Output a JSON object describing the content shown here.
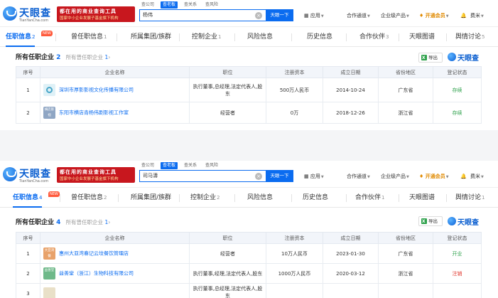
{
  "header": {
    "logo_text": "天眼查",
    "logo_sub": "TianYanCha.com",
    "banner_line1": "都在用的商业查询工具",
    "banner_line2": "国家中小企业发展子基金旗下机构",
    "search_tabs": [
      "查公司",
      "查老板",
      "查关系",
      "查风险"
    ],
    "search_btn": "天眼一下",
    "nav": [
      "应用",
      "合作通道",
      "企业级产品",
      "开通会员"
    ],
    "user": "费米"
  },
  "panels": [
    {
      "query": "杨伟",
      "tabs": [
        {
          "label": "任职信息",
          "count": "2"
        },
        {
          "label": "曾任职信息",
          "count": "1"
        },
        {
          "label": "所属集团/族群",
          "count": ""
        },
        {
          "label": "控制企业",
          "count": "1"
        },
        {
          "label": "风险信息",
          "count": ""
        },
        {
          "label": "历史信息",
          "count": ""
        },
        {
          "label": "合作伙伴",
          "count": "3"
        },
        {
          "label": "天眼图谱",
          "count": ""
        },
        {
          "label": "舆情讨论",
          "count": "5"
        }
      ],
      "section": {
        "title": "所有任职企业",
        "count": "2",
        "sub": "所有曾任职企业",
        "sub_count": "1"
      },
      "rows": [
        {
          "idx": "1",
          "logo": "",
          "logo_color": "#dff1f7",
          "company": "深圳市厚影影视文化传播有限公司",
          "position": "执行董事,总经理,法定代表人,股东",
          "capital": "500万人民币",
          "date": "2014-10-24",
          "region": "广东省",
          "status": "存续",
          "status_kind": "ok"
        },
        {
          "idx": "2",
          "logo": "横店影视",
          "logo_color": "#8fa6c4",
          "company": "东阳市横店青杨伟剧影视工作室",
          "position": "经营者",
          "capital": "0万",
          "date": "2018-12-26",
          "region": "浙江省",
          "status": "存续",
          "status_kind": "ok"
        }
      ]
    },
    {
      "query": "司马濤",
      "tabs": [
        {
          "label": "任职信息",
          "count": "4"
        },
        {
          "label": "曾任职信息",
          "count": "2"
        },
        {
          "label": "所属集团/族群",
          "count": ""
        },
        {
          "label": "控制企业",
          "count": "2"
        },
        {
          "label": "风险信息",
          "count": ""
        },
        {
          "label": "历史信息",
          "count": ""
        },
        {
          "label": "合作伙伴",
          "count": "1"
        },
        {
          "label": "天眼图谱",
          "count": ""
        },
        {
          "label": "舆情讨论",
          "count": "1"
        }
      ],
      "section": {
        "title": "所有任职企业",
        "count": "4",
        "sub": "所有曾任职企业",
        "sub_count": "1"
      },
      "rows": [
        {
          "idx": "1",
          "logo": "大亚湾餐",
          "logo_color": "#e8a26a",
          "company": "惠州大亚湾春记云坟餐饮管理店",
          "position": "经营者",
          "capital": "10万人民币",
          "date": "2023-01-30",
          "region": "广东省",
          "status": "开业",
          "status_kind": "ok"
        },
        {
          "idx": "2",
          "logo": "益善堂",
          "logo_color": "#6fb98a",
          "company": "益善堂（浙江）生物科技有限公司",
          "position": "执行董事,经理,法定代表人,股东",
          "capital": "1000万人民币",
          "date": "2020-03-12",
          "region": "浙江省",
          "status": "注销",
          "status_kind": "bad"
        },
        {
          "idx": "3",
          "logo": "",
          "logo_color": "#e9e0c8",
          "company": "",
          "position": "执行董事,总经理,法定代表人,股东",
          "capital": "",
          "date": "",
          "region": "",
          "status": "",
          "status_kind": "ok"
        }
      ]
    }
  ],
  "table_headers": [
    "序号",
    "企业名称",
    "职位",
    "注册资本",
    "成立日期",
    "省份地区",
    "登记状态"
  ],
  "export_label": "导出",
  "mini_logo": "天眼查",
  "new_badge": "NEW"
}
